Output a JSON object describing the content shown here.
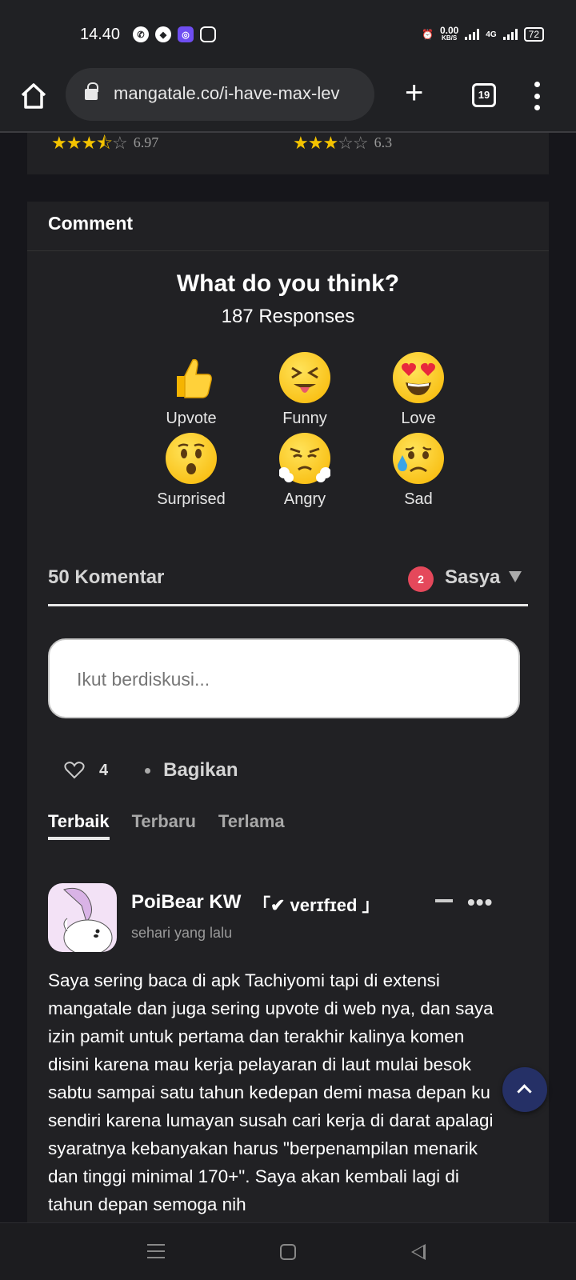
{
  "status_bar": {
    "time": "14.40",
    "net_speed": "0.00",
    "net_unit": "KB/S",
    "network": "4G",
    "battery": "72"
  },
  "browser": {
    "url": "mangatale.co/i-have-max-lev",
    "tab_count": "19"
  },
  "top_ratings": [
    {
      "score": "6.97",
      "stars": 3.5
    },
    {
      "score": "6.3",
      "stars": 3
    }
  ],
  "comment_section": {
    "heading": "Comment",
    "question": "What do you think?",
    "responses": "187 Responses",
    "reactions": [
      {
        "label": "Upvote",
        "icon": "thumbs-up-icon"
      },
      {
        "label": "Funny",
        "icon": "squinting-tongue-face-icon"
      },
      {
        "label": "Love",
        "icon": "heart-eyes-face-icon"
      },
      {
        "label": "Surprised",
        "icon": "hushed-face-icon"
      },
      {
        "label": "Angry",
        "icon": "steam-face-icon"
      },
      {
        "label": "Sad",
        "icon": "sad-sweat-face-icon"
      }
    ],
    "comment_count": "50 Komentar",
    "notification_count": "2",
    "user_name": "Sasya",
    "input_placeholder": "Ikut berdiskusi...",
    "like_count": "4",
    "share_label": "Bagikan",
    "sort_tabs": [
      "Terbaik",
      "Terbaru",
      "Terlama"
    ],
    "active_sort": "Terbaik"
  },
  "comment": {
    "author": "PoiBear KW",
    "badge": "「✔ verɪfɪed 」",
    "time": "sehari yang lalu",
    "text": "Saya sering baca di apk Tachiyomi tapi di extensi mangatale dan juga sering upvote di web nya, dan saya izin pamit untuk pertama dan terakhir kalinya komen disini karena mau kerja pelayaran di laut mulai besok sabtu sampai satu tahun kedepan demi masa depan ku sendiri karena lumayan susah cari kerja di darat apalagi syaratnya kebanyakan harus \"berpenampilan menarik dan tinggi minimal 170+\". Saya akan kembali lagi di tahun depan semoga nih"
  },
  "colors": {
    "accent_badge": "#e5485b",
    "star": "#f4c300",
    "scroll_button": "#253066"
  }
}
